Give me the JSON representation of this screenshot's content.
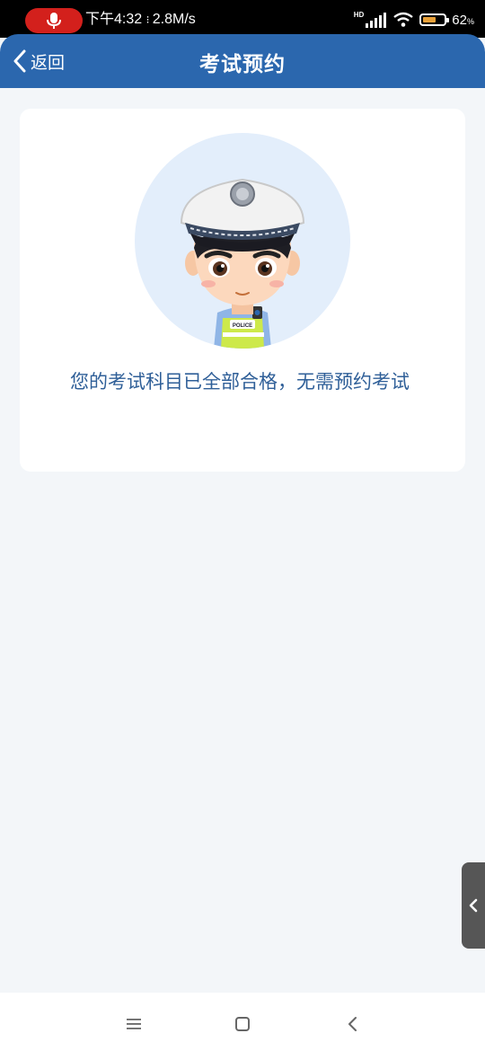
{
  "status_bar": {
    "time": "下午4:32",
    "network_speed": "2.8M/s",
    "hd_label": "HD",
    "battery_percent": "62",
    "battery_unit": "%",
    "battery_level": 0.62,
    "battery_color": "#e8a13a",
    "recording_color": "#d3201c",
    "icons": [
      "microphone-icon",
      "signal-icon",
      "wifi-icon",
      "battery-icon"
    ]
  },
  "header": {
    "back_label": "返回",
    "title": "考试预约",
    "background": "#2b67ae"
  },
  "card": {
    "avatar": "police-officer-avatar",
    "message": "您的考试科目已全部合格，无需预约考试",
    "badge_text": "POLICE"
  },
  "side_tab": {
    "icon": "chevron-left-icon"
  },
  "nav_bar": {
    "buttons": [
      "menu-icon",
      "home-icon",
      "back-icon"
    ]
  }
}
